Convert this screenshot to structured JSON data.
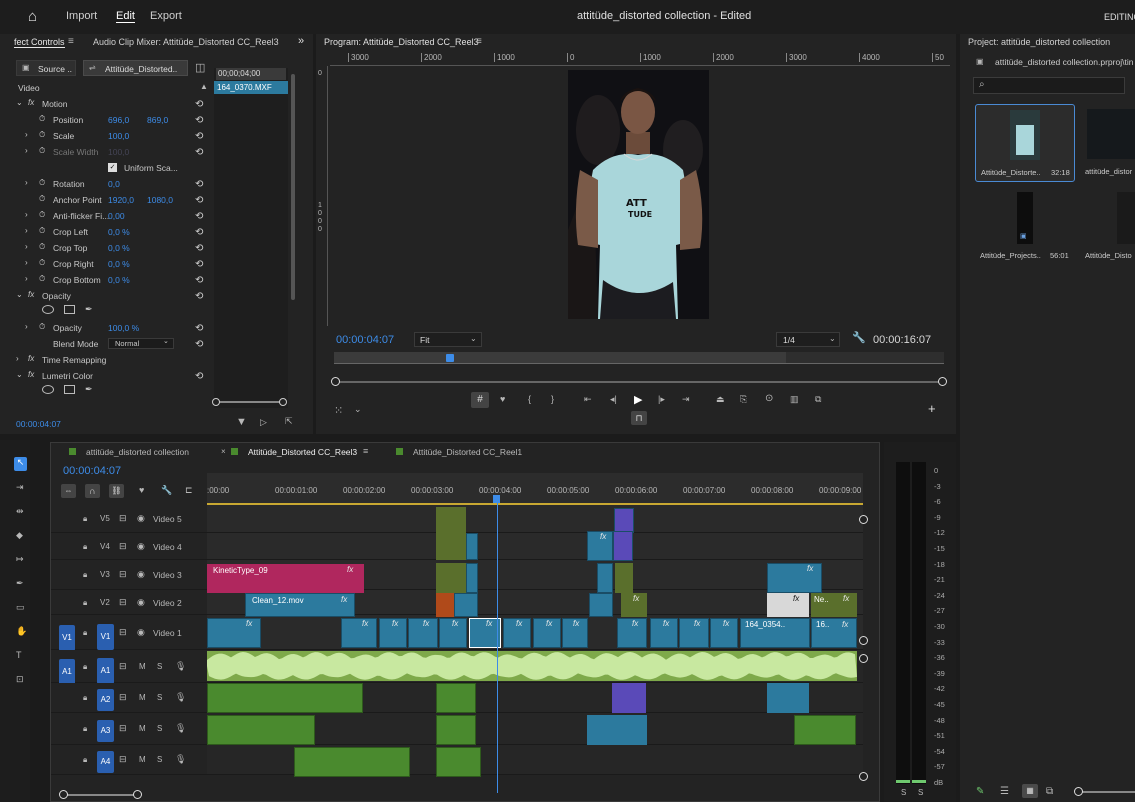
{
  "topbar": {
    "import": "Import",
    "edit": "Edit",
    "export": "Export",
    "title": "attitüde_distorted collection - Edited",
    "workspace": "EDITING"
  },
  "effect_controls": {
    "tab_effect_controls": "fect Controls",
    "tab_audio_mixer": "Audio Clip Mixer: Attitüde_Distorted CC_Reel3",
    "source_btn": "Source ..",
    "clip_btn": "Attitüde_Distorted..",
    "mini_timecode": "00;00;04;00",
    "mini_clip": "164_0370.MXF",
    "video_label": "Video",
    "rows": [
      {
        "name": "Motion",
        "v1": "",
        "v2": ""
      },
      {
        "name": "Position",
        "v1": "696,0",
        "v2": "869,0"
      },
      {
        "name": "Scale",
        "v1": "100,0",
        "v2": ""
      },
      {
        "name": "Scale Width",
        "v1": "100,0",
        "v2": ""
      },
      {
        "name": "Uniform Sca...",
        "v1": "",
        "v2": ""
      },
      {
        "name": "Rotation",
        "v1": "0,0",
        "v2": ""
      },
      {
        "name": "Anchor Point",
        "v1": "1920,0",
        "v2": "1080,0"
      },
      {
        "name": "Anti-flicker Fi...",
        "v1": "0,00",
        "v2": ""
      },
      {
        "name": "Crop Left",
        "v1": "0,0 %",
        "v2": ""
      },
      {
        "name": "Crop Top",
        "v1": "0,0 %",
        "v2": ""
      },
      {
        "name": "Crop Right",
        "v1": "0,0 %",
        "v2": ""
      },
      {
        "name": "Crop Bottom",
        "v1": "0,0 %",
        "v2": ""
      },
      {
        "name": "Opacity",
        "v1": "",
        "v2": ""
      },
      {
        "name": "Opacity",
        "v1": "100,0 %",
        "v2": ""
      },
      {
        "name": "Blend Mode",
        "v1": "Normal",
        "v2": ""
      },
      {
        "name": "Time Remapping",
        "v1": "",
        "v2": ""
      },
      {
        "name": "Lumetri Color",
        "v1": "",
        "v2": ""
      }
    ],
    "timecode": "00:00:04:07"
  },
  "program": {
    "title": "Program: Attitüde_Distorted CC_Reel3",
    "ruler": [
      "3000",
      "2000",
      "1000",
      "0",
      "1000",
      "2000",
      "3000",
      "4000",
      "50"
    ],
    "vruler": [
      "0",
      "1",
      "0",
      "0",
      "0"
    ],
    "timecode": "00:00:04:07",
    "fit": "Fit",
    "resolution": "1/4",
    "duration": "00:00:16:07",
    "shirt_text": "ATT TUDE"
  },
  "project": {
    "title": "Project: attitüde_distorted collection",
    "file": "attitüde_distorted collection.prproj\\tin",
    "items": [
      {
        "name": "Attitüde_Distorte..",
        "duration": "32:18"
      },
      {
        "name": "attitüde_distor",
        "duration": ""
      },
      {
        "name": "Attitüde_Projects..",
        "duration": "56:01"
      },
      {
        "name": "Attitüde_Disto",
        "duration": ""
      }
    ]
  },
  "timeline": {
    "tabs": [
      "attitüde_distorted collection",
      "Attitüde_Distorted CC_Reel3",
      "Attitüde_Distorted CC_Reel1"
    ],
    "timecode": "00:00:04:07",
    "ruler": [
      ":00:00",
      "00:00:01:00",
      "00:00:02:00",
      "00:00:03:00",
      "00:00:04:00",
      "00:00:05:00",
      "00:00:06:00",
      "00:00:07:00",
      "00:00:08:00",
      "00:00:09:00"
    ],
    "tracks": [
      {
        "id": "V5",
        "name": "Video 5"
      },
      {
        "id": "V4",
        "name": "Video 4"
      },
      {
        "id": "V3",
        "name": "Video 3"
      },
      {
        "id": "V2",
        "name": "Video 2"
      },
      {
        "id": "V1",
        "name": "Video 1"
      },
      {
        "id": "A1",
        "name": "M"
      },
      {
        "id": "A2",
        "name": "M"
      },
      {
        "id": "A3",
        "name": "M"
      },
      {
        "id": "A4",
        "name": "M"
      }
    ],
    "clip_kinetic": "KineticType_09",
    "clip_clean": "Clean_12.mov",
    "clip_164": "164_0354..",
    "clip_16": "16..",
    "clip_ne": "Ne..",
    "fx": "fx",
    "src_v1": "V1",
    "src_a1": "A1",
    "solo": "S"
  },
  "meter": {
    "labels": [
      "0",
      "-3",
      "-6",
      "-9",
      "-12",
      "-15",
      "-18",
      "-21",
      "-24",
      "-27",
      "-30",
      "-33",
      "-36",
      "-39",
      "-42",
      "-45",
      "-48",
      "-51",
      "-54",
      "-57",
      "dB"
    ],
    "s1": "S",
    "s2": "S"
  }
}
